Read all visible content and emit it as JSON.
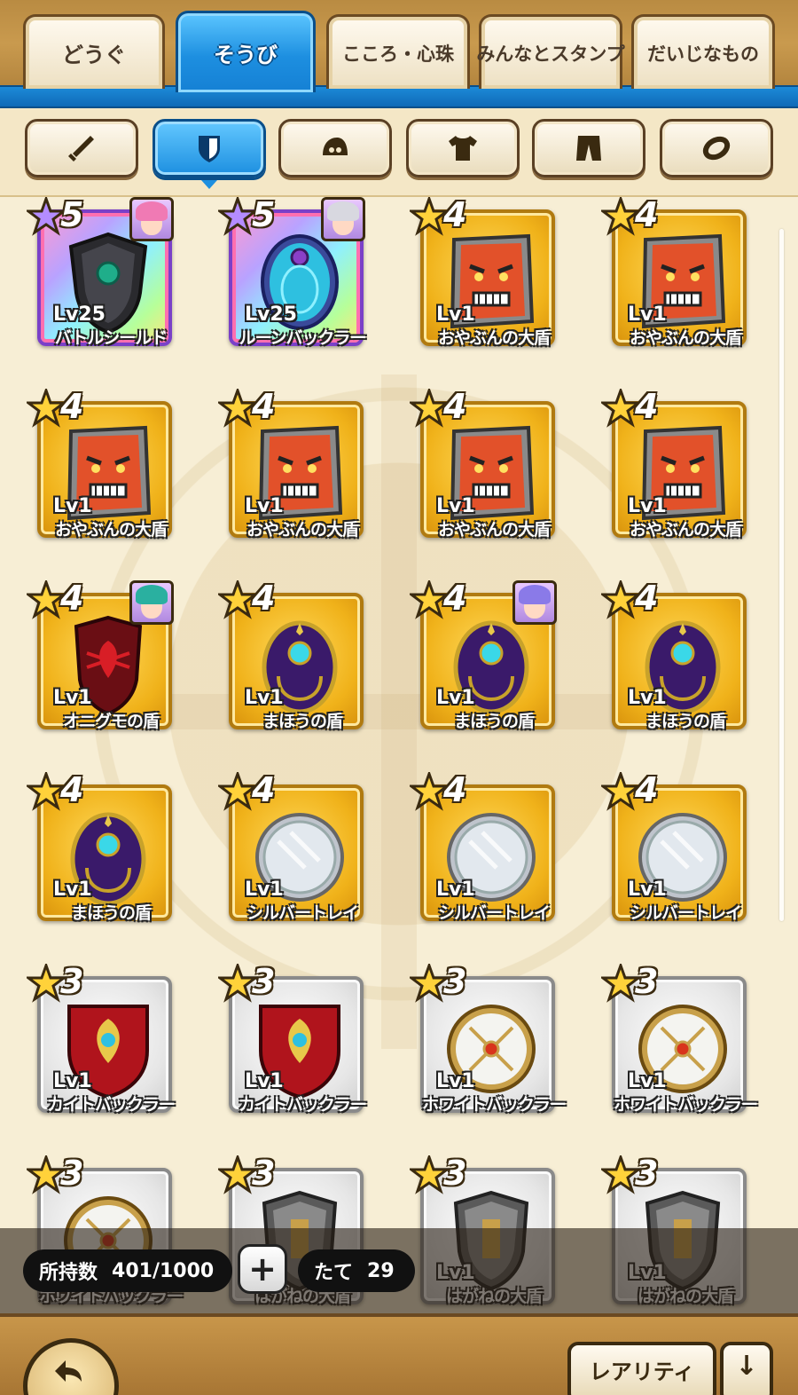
{
  "tabs": [
    {
      "label": "どうぐ",
      "active": false
    },
    {
      "label": "そうび",
      "active": true
    },
    {
      "label": "こころ・心珠",
      "active": false
    },
    {
      "label": "みんなとスタンプ",
      "active": false
    },
    {
      "label": "だいじなもの",
      "active": false
    }
  ],
  "filters": [
    {
      "icon": "sword-icon",
      "active": false
    },
    {
      "icon": "shield-icon",
      "active": true
    },
    {
      "icon": "helmet-icon",
      "active": false
    },
    {
      "icon": "shirt-icon",
      "active": false
    },
    {
      "icon": "pants-icon",
      "active": false
    },
    {
      "icon": "ring-icon",
      "active": false
    }
  ],
  "items": [
    {
      "rarity": "5",
      "level": "Lv25",
      "name": "バトルシールド",
      "icon": "battle-shield-icon",
      "equipped_by": "pink-hair-character-icon"
    },
    {
      "rarity": "5",
      "level": "Lv25",
      "name": "ルーンバックラー",
      "icon": "rune-buckler-icon",
      "equipped_by": "silver-hair-character-icon"
    },
    {
      "rarity": "4",
      "level": "Lv1",
      "name": "おやぶんの大盾",
      "icon": "oyabun-shield-icon"
    },
    {
      "rarity": "4",
      "level": "Lv1",
      "name": "おやぶんの大盾",
      "icon": "oyabun-shield-icon"
    },
    {
      "rarity": "4",
      "level": "Lv1",
      "name": "おやぶんの大盾",
      "icon": "oyabun-shield-icon"
    },
    {
      "rarity": "4",
      "level": "Lv1",
      "name": "おやぶんの大盾",
      "icon": "oyabun-shield-icon"
    },
    {
      "rarity": "4",
      "level": "Lv1",
      "name": "おやぶんの大盾",
      "icon": "oyabun-shield-icon"
    },
    {
      "rarity": "4",
      "level": "Lv1",
      "name": "おやぶんの大盾",
      "icon": "oyabun-shield-icon"
    },
    {
      "rarity": "4",
      "level": "Lv1",
      "name": "オニグモの盾",
      "icon": "onigumo-shield-icon",
      "equipped_by": "teal-hair-character-icon"
    },
    {
      "rarity": "4",
      "level": "Lv1",
      "name": "まほうの盾",
      "icon": "magic-shield-icon"
    },
    {
      "rarity": "4",
      "level": "Lv1",
      "name": "まほうの盾",
      "icon": "magic-shield-icon",
      "equipped_by": "purple-hair-character-icon"
    },
    {
      "rarity": "4",
      "level": "Lv1",
      "name": "まほうの盾",
      "icon": "magic-shield-icon"
    },
    {
      "rarity": "4",
      "level": "Lv1",
      "name": "まほうの盾",
      "icon": "magic-shield-icon"
    },
    {
      "rarity": "4",
      "level": "Lv1",
      "name": "シルバートレイ",
      "icon": "silver-tray-icon"
    },
    {
      "rarity": "4",
      "level": "Lv1",
      "name": "シルバートレイ",
      "icon": "silver-tray-icon"
    },
    {
      "rarity": "4",
      "level": "Lv1",
      "name": "シルバートレイ",
      "icon": "silver-tray-icon"
    },
    {
      "rarity": "3",
      "level": "Lv1",
      "name": "カイトバックラー",
      "icon": "kite-buckler-icon"
    },
    {
      "rarity": "3",
      "level": "Lv1",
      "name": "カイトバックラー",
      "icon": "kite-buckler-icon"
    },
    {
      "rarity": "3",
      "level": "Lv1",
      "name": "ホワイトバックラー",
      "icon": "white-buckler-icon"
    },
    {
      "rarity": "3",
      "level": "Lv1",
      "name": "ホワイトバックラー",
      "icon": "white-buckler-icon"
    },
    {
      "rarity": "3",
      "level": "",
      "name": "ホワイトバックラー",
      "icon": "white-buckler-icon"
    },
    {
      "rarity": "3",
      "level": "",
      "name": "はがねの大盾",
      "icon": "steel-shield-icon"
    },
    {
      "rarity": "3",
      "level": "Lv1",
      "name": "はがねの大盾",
      "icon": "steel-shield-icon"
    },
    {
      "rarity": "3",
      "level": "Lv1",
      "name": "はがねの大盾",
      "icon": "steel-shield-icon"
    }
  ],
  "status": {
    "owned_label": "所持数",
    "owned_value": "401/1000",
    "plus_label": "+",
    "category_label": "たて",
    "category_count": "29"
  },
  "footer": {
    "sort_label": "レアリティ",
    "order_symbol": "↓"
  },
  "colors": {
    "active_tab": "#1d8fe0",
    "gold_frame": "#f0b21a",
    "bronze_frame": "#e6e6e6",
    "rainbow_frame": "#b9a2ff"
  }
}
